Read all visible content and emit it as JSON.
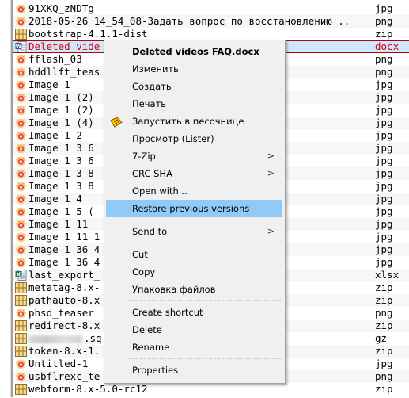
{
  "file_list": {
    "rows": [
      {
        "name": "91XKQ_zNDTg",
        "ext": "jpg",
        "icon": "image-viewer-icon"
      },
      {
        "name": "2018-05-26 14_54_08-Задать вопрос по восстановлению ..",
        "ext": "png",
        "icon": "image-viewer-icon"
      },
      {
        "name": "bootstrap-4.1.1-dist",
        "ext": "zip",
        "icon": "archive-icon"
      },
      {
        "name": "Deleted vide",
        "ext": "docx",
        "icon": "word-document-icon",
        "selected": true
      },
      {
        "name": "fflash_03",
        "ext": "png",
        "icon": "image-viewer-icon"
      },
      {
        "name": "hddllft_teas",
        "ext": "png",
        "icon": "image-viewer-icon"
      },
      {
        "name": "Image 1",
        "ext": "jpg",
        "icon": "image-viewer-icon"
      },
      {
        "name": "Image 1 (2)",
        "ext": "jpg",
        "icon": "image-viewer-icon"
      },
      {
        "name": "Image 1 (2)",
        "ext": "jpg",
        "icon": "image-viewer-icon"
      },
      {
        "name": "Image 1 (4)",
        "ext": "jpg",
        "icon": "image-viewer-icon"
      },
      {
        "name": "Image 1 2",
        "ext": "jpg",
        "icon": "image-viewer-icon"
      },
      {
        "name": "Image 1  3 6",
        "ext": "jpg",
        "icon": "image-viewer-icon"
      },
      {
        "name": "Image 1  3 6",
        "ext": "jpg",
        "icon": "image-viewer-icon"
      },
      {
        "name": "Image 1  3 8",
        "ext": "jpg",
        "icon": "image-viewer-icon"
      },
      {
        "name": "Image 1  3 8",
        "ext": "jpg",
        "icon": "image-viewer-icon"
      },
      {
        "name": "Image 1  4",
        "ext": "jpg",
        "icon": "image-viewer-icon"
      },
      {
        "name": "Image 1  5 (",
        "ext": "jpg",
        "icon": "image-viewer-icon"
      },
      {
        "name": "Image 1 11",
        "ext": "jpg",
        "icon": "image-viewer-icon"
      },
      {
        "name": "Image 1 11 1",
        "ext": "jpg",
        "icon": "image-viewer-icon"
      },
      {
        "name": "Image 1 36 4",
        "ext": "jpg",
        "icon": "image-viewer-icon"
      },
      {
        "name": "Image 1 36 4",
        "ext": "jpg",
        "icon": "image-viewer-icon"
      },
      {
        "name": "last_export_",
        "ext": "xlsx",
        "icon": "excel-document-icon"
      },
      {
        "name": "metatag-8.x-",
        "ext": "zip",
        "icon": "archive-icon"
      },
      {
        "name": "pathauto-8.x",
        "ext": "zip",
        "icon": "archive-icon"
      },
      {
        "name": "phsd_teaser",
        "ext": "png",
        "icon": "image-viewer-icon"
      },
      {
        "name": "redirect-8.x",
        "ext": "zip",
        "icon": "archive-icon"
      },
      {
        "name": ".sq",
        "ext": "gz",
        "icon": "archive-icon",
        "blurred_prefix": true
      },
      {
        "name": "token-8.x-1.",
        "ext": "zip",
        "icon": "archive-icon"
      },
      {
        "name": "Untitled-1",
        "ext": "jpg",
        "icon": "image-viewer-icon"
      },
      {
        "name": "usbflrexc_te",
        "ext": "png",
        "icon": "image-viewer-icon"
      },
      {
        "name": "webform-8.x-5.0-rc12",
        "ext": "zip",
        "icon": "archive-icon"
      }
    ]
  },
  "context_menu": {
    "items": [
      {
        "type": "item",
        "label": "Deleted videos FAQ.docx",
        "bold": true
      },
      {
        "type": "item",
        "label": "Изменить"
      },
      {
        "type": "item",
        "label": "Создать"
      },
      {
        "type": "item",
        "label": "Печать"
      },
      {
        "type": "item",
        "label": "Запустить в песочнице",
        "icon": "sandbox-icon"
      },
      {
        "type": "item",
        "label": "Просмотр (Lister)"
      },
      {
        "type": "item",
        "label": "7-Zip",
        "submenu": true
      },
      {
        "type": "item",
        "label": "CRC SHA",
        "submenu": true
      },
      {
        "type": "item",
        "label": "Open with..."
      },
      {
        "type": "item",
        "label": "Restore previous versions",
        "hover": true
      },
      {
        "type": "separator"
      },
      {
        "type": "item",
        "label": "Send to",
        "submenu": true
      },
      {
        "type": "separator"
      },
      {
        "type": "item",
        "label": "Cut"
      },
      {
        "type": "item",
        "label": "Copy"
      },
      {
        "type": "item",
        "label": "Упаковка файлов"
      },
      {
        "type": "separator"
      },
      {
        "type": "item",
        "label": "Create shortcut"
      },
      {
        "type": "item",
        "label": "Delete"
      },
      {
        "type": "item",
        "label": "Rename"
      },
      {
        "type": "separator"
      },
      {
        "type": "item",
        "label": "Properties"
      }
    ],
    "submenu_arrow": ">"
  },
  "colors": {
    "selection_bg": "#cce8ff",
    "selection_border": "#c00000",
    "selection_text": "#e00000",
    "menu_bg": "#f0f0f0",
    "menu_hover": "#91c9f7"
  }
}
